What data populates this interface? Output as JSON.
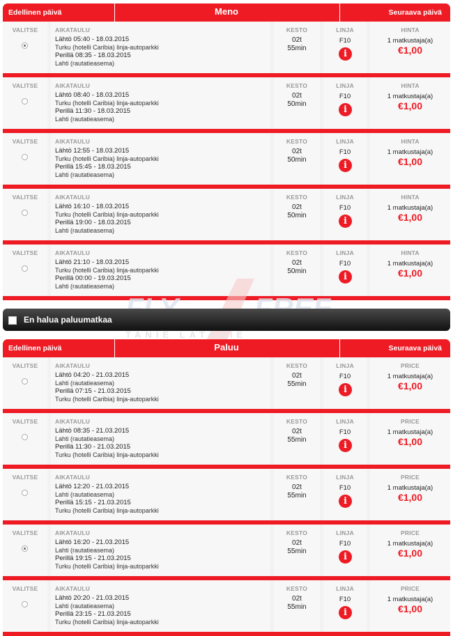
{
  "outbound": {
    "prev_label": "Edellinen päivä",
    "title": "Meno",
    "next_label": "Seuraava päivä",
    "col_select": "VALITSE",
    "col_schedule": "AIKATAULU",
    "col_duration": "KESTO",
    "col_line": "LINJA",
    "col_price": "HINTA",
    "rows": [
      {
        "dep": "Lähtö 05:40 - 18.03.2015",
        "from": "Turku (hotelli Caribia) linja-autoparkki",
        "arr": "Perillä 08:35 - 18.03.2015",
        "to": "Lahti (rautatieasema)",
        "dur1": "02t",
        "dur2": "55min",
        "line": "F10",
        "pax": "1 matkustaja(a)",
        "price": "€1,00",
        "selected": true
      },
      {
        "dep": "Lähtö 08:40 - 18.03.2015",
        "from": "Turku (hotelli Caribia) linja-autoparkki",
        "arr": "Perillä 11:30 - 18.03.2015",
        "to": "Lahti (rautatieasema)",
        "dur1": "02t",
        "dur2": "50min",
        "line": "F10",
        "pax": "1 matkustaja(a)",
        "price": "€1,00",
        "selected": false
      },
      {
        "dep": "Lähtö 12:55 - 18.03.2015",
        "from": "Turku (hotelli Caribia) linja-autoparkki",
        "arr": "Perillä 15:45 - 18.03.2015",
        "to": "Lahti (rautatieasema)",
        "dur1": "02t",
        "dur2": "50min",
        "line": "F10",
        "pax": "1 matkustaja(a)",
        "price": "€1,00",
        "selected": false
      },
      {
        "dep": "Lähtö 16:10 - 18.03.2015",
        "from": "Turku (hotelli Caribia) linja-autoparkki",
        "arr": "Perillä 19:00 - 18.03.2015",
        "to": "Lahti (rautatieasema)",
        "dur1": "02t",
        "dur2": "50min",
        "line": "F10",
        "pax": "1 matkustaja(a)",
        "price": "€1,00",
        "selected": false
      },
      {
        "dep": "Lähtö 21:10 - 18.03.2015",
        "from": "Turku (hotelli Caribia) linja-autoparkki",
        "arr": "Perillä 00:00 - 19.03.2015",
        "to": "Lahti (rautatieasema)",
        "dur1": "02t",
        "dur2": "50min",
        "line": "F10",
        "pax": "1 matkustaja(a)",
        "price": "€1,00",
        "selected": false
      }
    ]
  },
  "no_return_label": "En halua paluumatkaa",
  "watermark": {
    "main": "FLY4FREE",
    "sub": "TANIE LATANIE"
  },
  "return": {
    "prev_label": "Edellinen päivä",
    "title": "Paluu",
    "next_label": "Seuraava päivä",
    "col_select": "VALITSE",
    "col_schedule": "AIKATAULU",
    "col_duration": "KESTO",
    "col_line": "LINJA",
    "col_price": "PRICE",
    "rows": [
      {
        "dep": "Lähtö 04:20 - 21.03.2015",
        "from": "Lahti (rautatieasema)",
        "arr": "Perillä 07:15 - 21.03.2015",
        "to": "Turku (hotelli Caribia) linja-autoparkki",
        "dur1": "02t",
        "dur2": "55min",
        "line": "F10",
        "pax": "1 matkustaja(a)",
        "price": "€1,00",
        "selected": false
      },
      {
        "dep": "Lähtö 08:35 - 21.03.2015",
        "from": "Lahti (rautatieasema)",
        "arr": "Perillä 11:30 - 21.03.2015",
        "to": "Turku (hotelli Caribia) linja-autoparkki",
        "dur1": "02t",
        "dur2": "55min",
        "line": "F10",
        "pax": "1 matkustaja(a)",
        "price": "€1,00",
        "selected": false
      },
      {
        "dep": "Lähtö 12:20 - 21.03.2015",
        "from": "Lahti (rautatieasema)",
        "arr": "Perillä 15:15 - 21.03.2015",
        "to": "Turku (hotelli Caribia) linja-autoparkki",
        "dur1": "02t",
        "dur2": "55min",
        "line": "F10",
        "pax": "1 matkustaja(a)",
        "price": "€1,00",
        "selected": false
      },
      {
        "dep": "Lähtö 16:20 - 21.03.2015",
        "from": "Lahti (rautatieasema)",
        "arr": "Perillä 19:15 - 21.03.2015",
        "to": "Turku (hotelli Caribia) linja-autoparkki",
        "dur1": "02t",
        "dur2": "55min",
        "line": "F10",
        "pax": "1 matkustaja(a)",
        "price": "€1,00",
        "selected": true
      },
      {
        "dep": "Lähtö 20:20 - 21.03.2015",
        "from": "Lahti (rautatieasema)",
        "arr": "Perillä 23:15 - 21.03.2015",
        "to": "Turku (hotelli Caribia) linja-autoparkki",
        "dur1": "02t",
        "dur2": "55min",
        "line": "F10",
        "pax": "1 matkustaja(a)",
        "price": "€1,00",
        "selected": false
      }
    ]
  }
}
